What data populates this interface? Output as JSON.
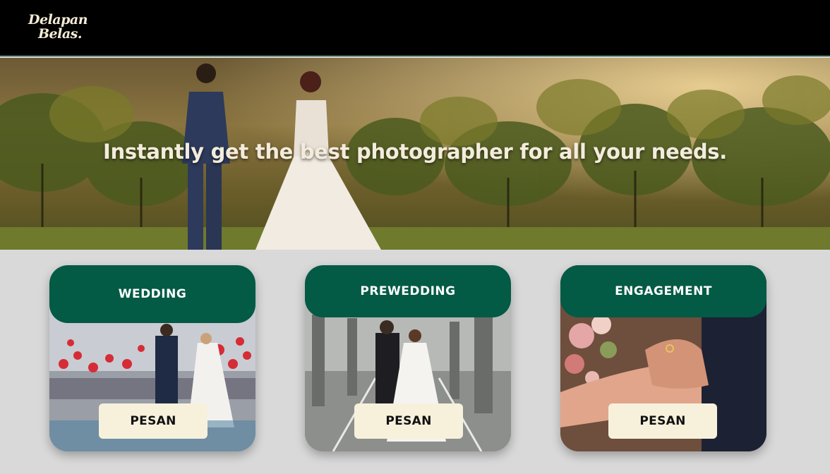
{
  "header": {
    "logo_line1": "Delapan",
    "logo_line2": "Belas."
  },
  "hero": {
    "title": "Instantly get the best photographer for all your needs."
  },
  "cards": [
    {
      "title": "WEDDING",
      "button": "PESAN"
    },
    {
      "title": "PREWEDDING",
      "button": "PESAN"
    },
    {
      "title": "ENGAGEMENT",
      "button": "PESAN"
    }
  ],
  "colors": {
    "header_bg": "#000000",
    "card_head": "#035a45",
    "button_bg": "#f7f1dc",
    "page_bg": "#d9d9d9"
  }
}
